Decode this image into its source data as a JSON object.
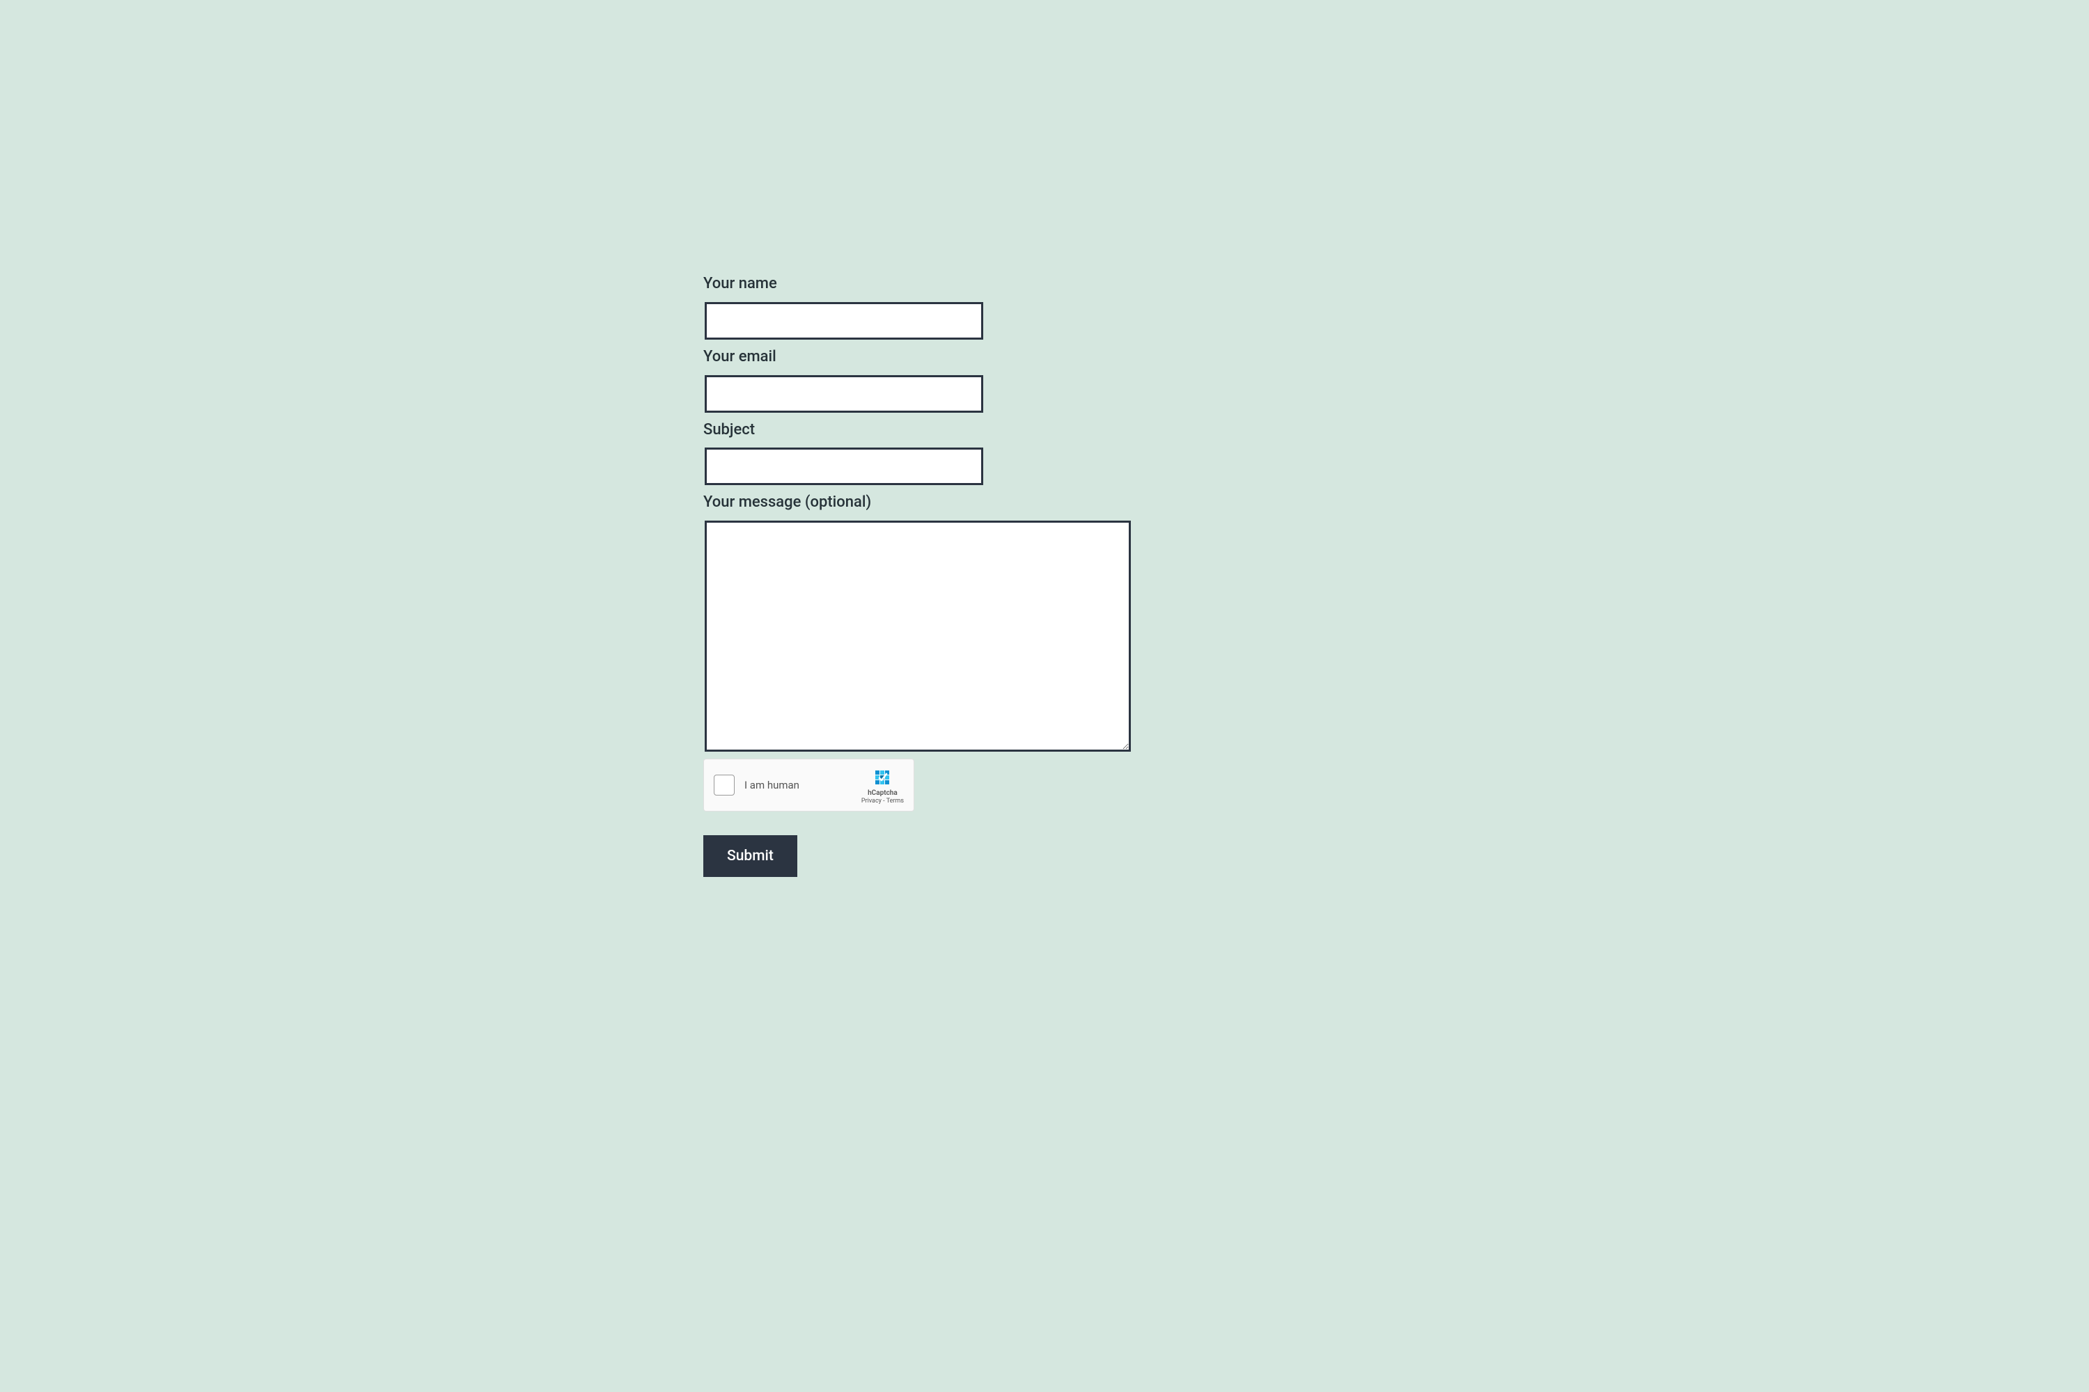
{
  "form": {
    "fields": {
      "name": {
        "label": "Your name",
        "value": ""
      },
      "email": {
        "label": "Your email",
        "value": ""
      },
      "subject": {
        "label": "Subject",
        "value": ""
      },
      "message": {
        "label": "Your message (optional)",
        "value": ""
      }
    },
    "captcha": {
      "label": "I am human",
      "brand": "hCaptcha",
      "privacy": "Privacy",
      "separator": " - ",
      "terms": "Terms"
    },
    "submit_label": "Submit"
  }
}
